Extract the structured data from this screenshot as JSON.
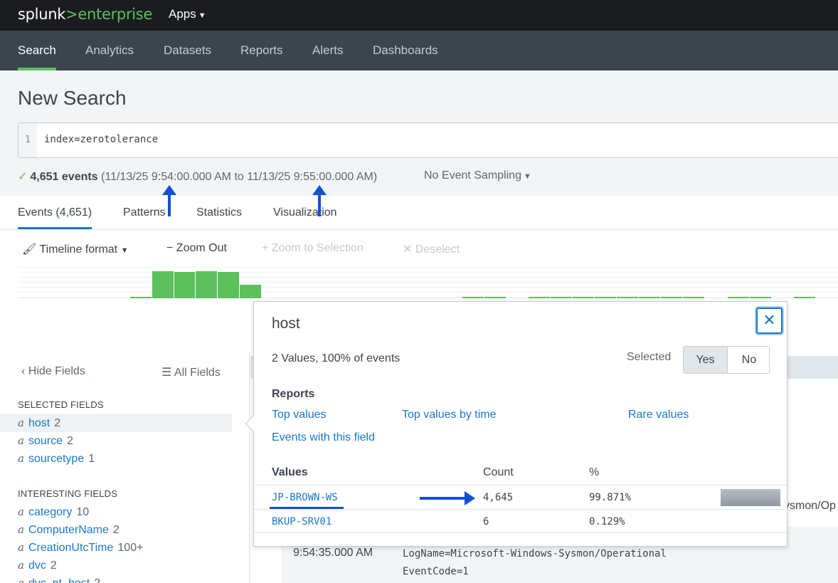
{
  "topbar": {
    "logo_prefix": "splunk",
    "logo_gt": ">",
    "logo_suffix": "enterprise",
    "apps_label": "Apps"
  },
  "nav": {
    "items": [
      "Search",
      "Analytics",
      "Datasets",
      "Reports",
      "Alerts",
      "Dashboards"
    ],
    "active": "Search"
  },
  "page": {
    "title": "New Search"
  },
  "search": {
    "line_number": "1",
    "query": "index=zerotolerance"
  },
  "status": {
    "events_count": "4,651 events",
    "time_range": "(11/13/25 9:54:00.000 AM to 11/13/25 9:55:00.000 AM)",
    "sampling_label": "No Event Sampling"
  },
  "tabs": {
    "events": "Events (4,651)",
    "patterns": "Patterns",
    "statistics": "Statistics",
    "visualization": "Visualization"
  },
  "timeline_tools": {
    "format": "Timeline format",
    "zoom_out": "Zoom Out",
    "zoom_selection": "Zoom to Selection",
    "deselect": "Deselect"
  },
  "sidebar": {
    "hide_fields": "Hide Fields",
    "all_fields": "All Fields",
    "selected_heading": "SELECTED FIELDS",
    "selected_fields": [
      {
        "type": "a",
        "name": "host",
        "count": "2"
      },
      {
        "type": "a",
        "name": "source",
        "count": "2"
      },
      {
        "type": "a",
        "name": "sourcetype",
        "count": "1"
      }
    ],
    "interesting_heading": "INTERESTING FIELDS",
    "interesting_fields": [
      {
        "type": "a",
        "name": "category",
        "count": "10"
      },
      {
        "type": "a",
        "name": "ComputerName",
        "count": "2"
      },
      {
        "type": "a",
        "name": "CreationUtcTime",
        "count": "100+"
      },
      {
        "type": "a",
        "name": "dvc",
        "count": "2"
      },
      {
        "type": "a",
        "name": "dvc_nt_host",
        "count": "2"
      }
    ]
  },
  "event": {
    "time": "9:54:35.000 AM",
    "line1": "LogName=Microsoft-Windows-Sysmon/Operational",
    "line2": "EventCode=1",
    "cut_text": "ysmon/Op"
  },
  "popup": {
    "title": "host",
    "subtitle": "2 Values, 100% of events",
    "selected_label": "Selected",
    "yes": "Yes",
    "no": "No",
    "reports_heading": "Reports",
    "links": {
      "top_values": "Top values",
      "top_values_by_time": "Top values by time",
      "rare_values": "Rare values",
      "events_with_field": "Events with this field"
    },
    "columns": {
      "values": "Values",
      "count": "Count",
      "percent": "%"
    },
    "rows": [
      {
        "value": "JP-BROWN-WS",
        "count": "4,645",
        "percent": "99.871%",
        "fraction": 0.99871
      },
      {
        "value": "BKUP-SRV01",
        "count": "6",
        "percent": "0.129%",
        "fraction": 0.00129
      }
    ]
  },
  "colors": {
    "accent_green": "#5cc05c",
    "link_blue": "#1a77c9",
    "annotation_blue": "#1350d4",
    "nav_bg": "#3c444d",
    "topbar_bg": "#1a1c20"
  }
}
